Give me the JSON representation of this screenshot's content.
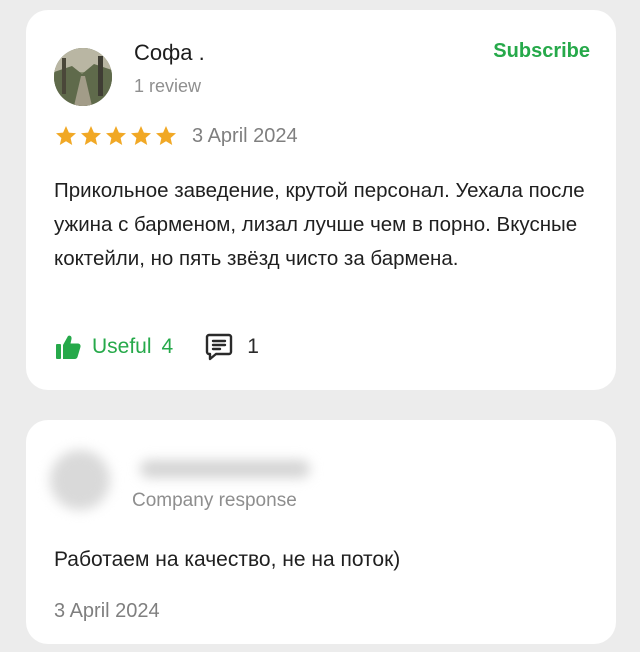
{
  "review": {
    "author_name": "Софа .",
    "author_meta": "1 review",
    "subscribe_label": "Subscribe",
    "rating": 5,
    "date": "3 April 2024",
    "text": "Прикольное заведение, крутой персонал. Уехала после ужина с барменом, лизал лучше чем в порно. Вкусные коктейли, но пять звёзд чисто за бармена.",
    "useful_label": "Useful",
    "useful_count": "4",
    "comment_count": "1"
  },
  "response": {
    "label": "Company response",
    "text": "Работаем на качество, не на поток)",
    "date": "3 April 2024"
  },
  "colors": {
    "accent_green": "#26a94a",
    "star_orange": "#f1a825",
    "secondary_text": "#8f8f8f"
  },
  "icons": {
    "star": "star-icon",
    "like": "thumbs-up-icon",
    "comment": "comment-icon"
  }
}
